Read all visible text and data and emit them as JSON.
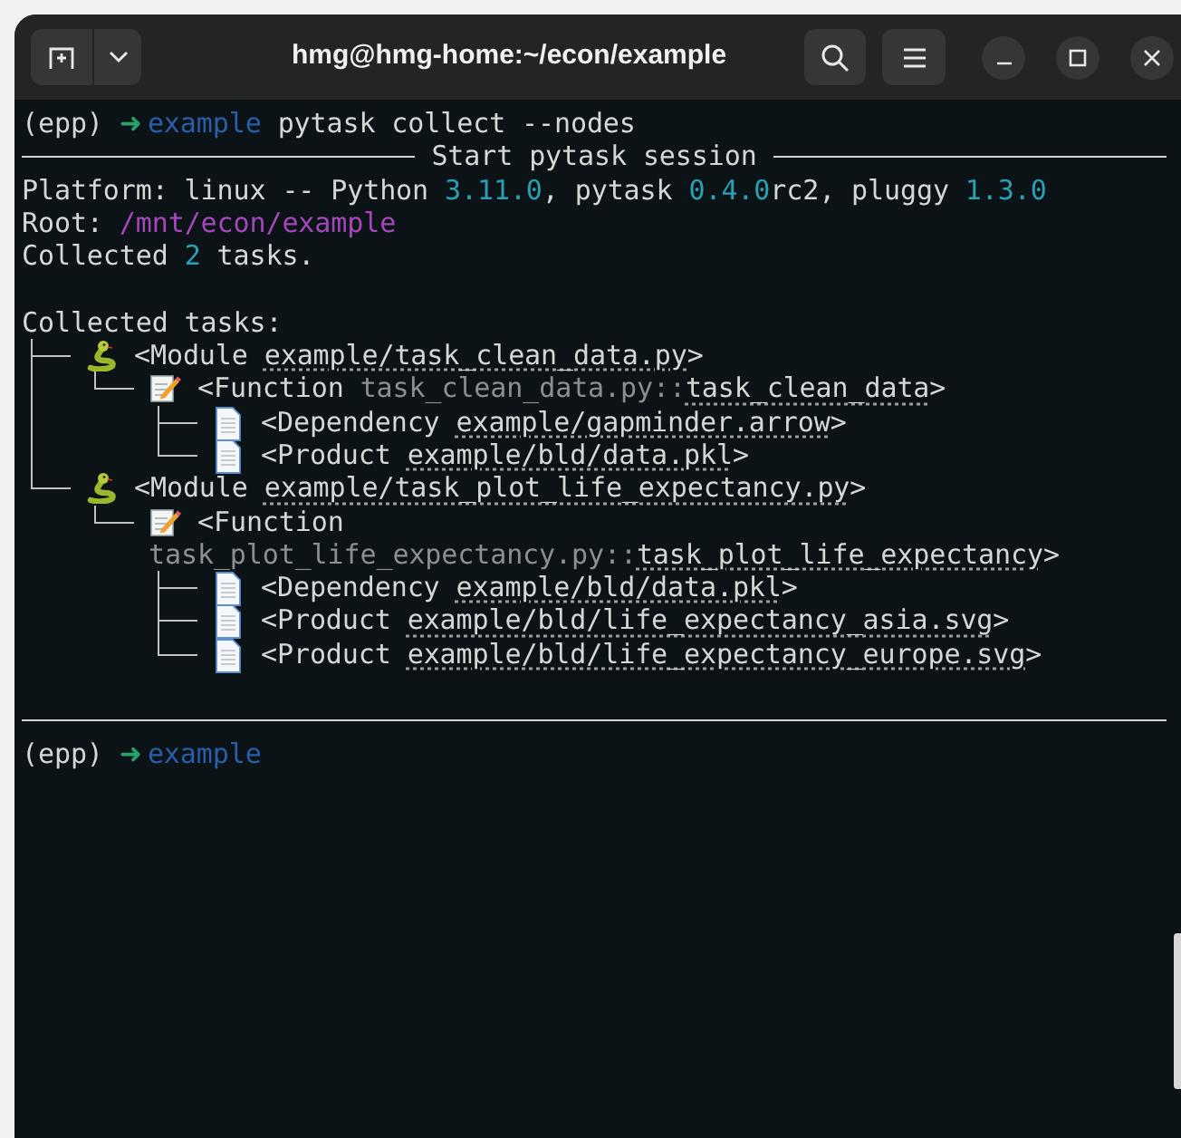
{
  "window": {
    "title": "hmg@hmg-home:~/econ/example"
  },
  "lines": [
    {
      "kind": "prompt",
      "env": "(epp)",
      "arrow": "➜",
      "dir": "example",
      "command": "pytask collect --nodes"
    },
    {
      "kind": "rule",
      "text": "Start pytask session"
    },
    {
      "kind": "text",
      "segments": [
        {
          "kind": "plain",
          "text": "Platform: linux -- Python "
        },
        {
          "kind": "number",
          "text": "3.11.0"
        },
        {
          "kind": "plain",
          "text": ", pytask "
        },
        {
          "kind": "number",
          "text": "0.4.0"
        },
        {
          "kind": "plain",
          "text": "rc2, pluggy "
        },
        {
          "kind": "number",
          "text": "1.3.0"
        }
      ]
    },
    {
      "kind": "text",
      "segments": [
        {
          "kind": "plain",
          "text": "Root: "
        },
        {
          "kind": "path",
          "text": "/mnt/econ/example"
        }
      ]
    },
    {
      "kind": "text",
      "segments": [
        {
          "kind": "plain",
          "text": "Collected "
        },
        {
          "kind": "number",
          "text": "2"
        },
        {
          "kind": "plain",
          "text": " tasks."
        }
      ]
    },
    {
      "kind": "blank"
    },
    {
      "kind": "text",
      "segments": [
        {
          "kind": "plain",
          "text": "Collected tasks:"
        }
      ]
    },
    {
      "kind": "tree",
      "nodes": [
        {
          "kind": "module",
          "prefix": "<Module",
          "target": "example/task_clean_data.py",
          "suffix": ">",
          "children": [
            {
              "kind": "function",
              "prefix": "<Function",
              "location": "task_clean_data.py::",
              "target": "task_clean_data",
              "suffix": ">",
              "children": [
                {
                  "kind": "file",
                  "prefix": "<Dependency",
                  "target": "example/gapminder.arrow",
                  "suffix": ">"
                },
                {
                  "kind": "file",
                  "prefix": "<Product",
                  "target": "example/bld/data.pkl",
                  "suffix": ">"
                }
              ]
            }
          ]
        },
        {
          "kind": "module",
          "prefix": "<Module",
          "target": "example/task_plot_life_expectancy.py",
          "suffix": ">",
          "children": [
            {
              "kind": "function",
              "prefix": "<Function",
              "location": "task_plot_life_expectancy.py::",
              "target": "task_plot_life_expectancy",
              "suffix": ">",
              "children": [
                {
                  "kind": "file",
                  "prefix": "<Dependency",
                  "target": "example/bld/data.pkl",
                  "suffix": ">"
                },
                {
                  "kind": "file",
                  "prefix": "<Product",
                  "target": "example/bld/life_expectancy_asia.svg",
                  "suffix": ">"
                },
                {
                  "kind": "file",
                  "prefix": "<Product",
                  "target": "example/bld/life_expectancy_europe.svg",
                  "suffix": ">"
                }
              ]
            }
          ]
        }
      ]
    },
    {
      "kind": "blank"
    },
    {
      "kind": "rule"
    },
    {
      "kind": "prompt",
      "env": "(epp)",
      "arrow": "➜",
      "dir": "example"
    }
  ]
}
